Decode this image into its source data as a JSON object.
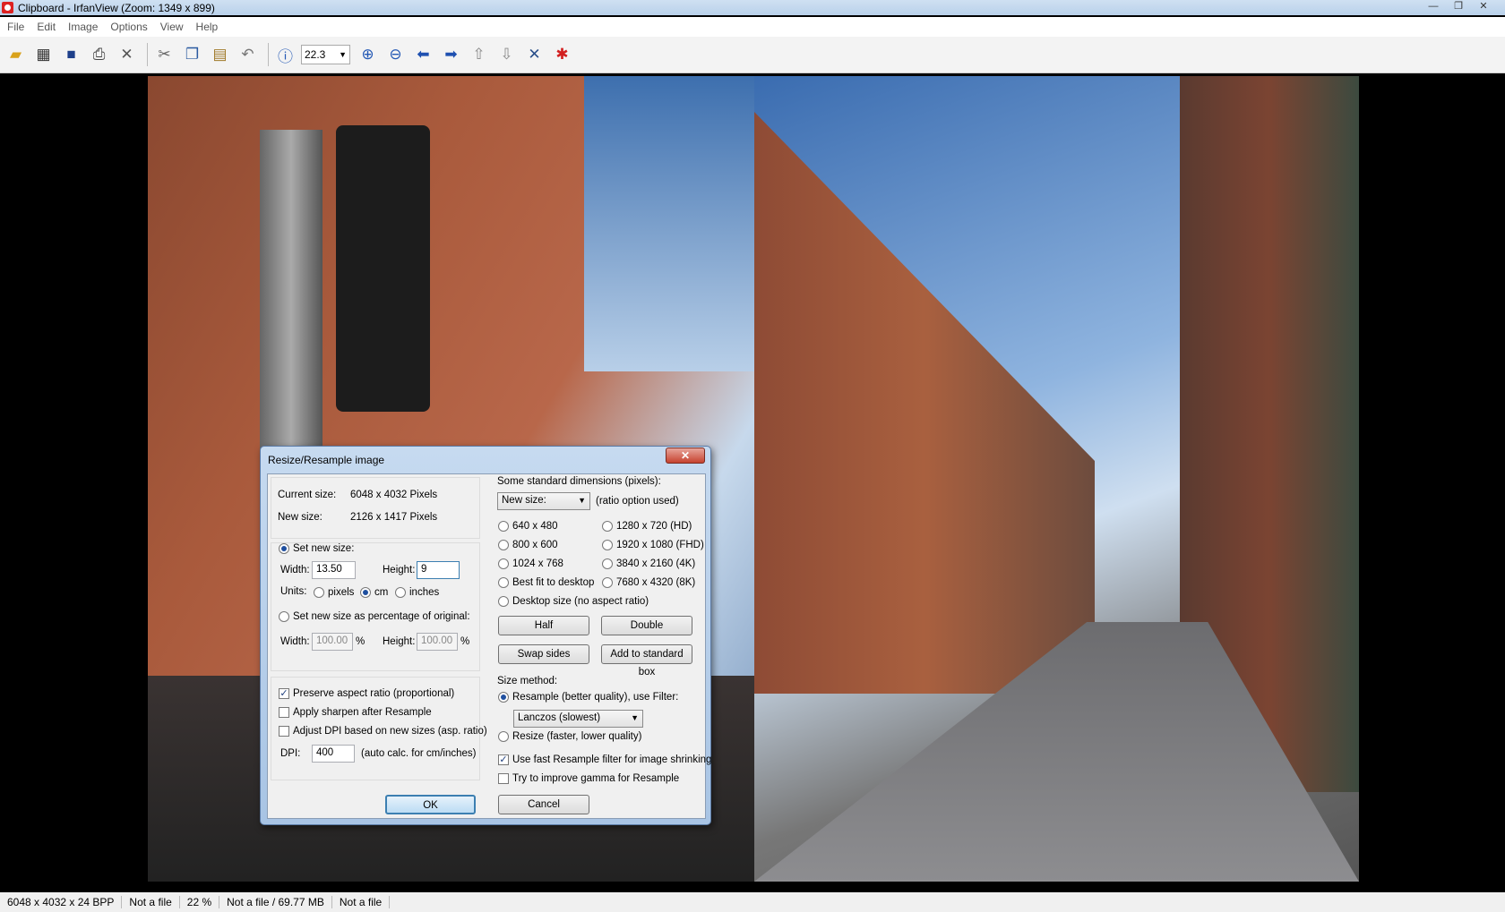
{
  "window": {
    "title": "Clipboard - IrfanView (Zoom: 1349 x 899)",
    "controls": [
      "—",
      "❐",
      "✕"
    ]
  },
  "menu": [
    "File",
    "Edit",
    "Image",
    "Options",
    "View",
    "Help"
  ],
  "toolbar": {
    "zoom_value": "22.3",
    "icons": [
      "open-folder-icon",
      "thumbnails-icon",
      "save-icon",
      "print-icon",
      "delete-icon",
      "cut-icon",
      "copy-icon",
      "paste-icon",
      "undo-icon",
      "info-icon",
      "zoom-in-icon",
      "zoom-out-icon",
      "previous-icon",
      "next-icon",
      "first-page-icon",
      "last-page-icon",
      "settings-icon",
      "exit-icon"
    ]
  },
  "statusbar": [
    "6048 x 4032 x 24 BPP",
    "Not a file",
    "22 %",
    "Not a file / 69.77 MB",
    "Not a file"
  ],
  "dialog": {
    "title": "Resize/Resample image",
    "close": "✕",
    "current_size_label": "Current size:",
    "current_size_value": "6048  x  4032  Pixels",
    "new_size_label": "New size:",
    "new_size_value": "2126  x  1417  Pixels",
    "set_new_size": "Set new size:",
    "width_label": "Width:",
    "width_value": "13.50",
    "height_label": "Height:",
    "height_value": "9",
    "units_label": "Units:",
    "unit_pixels": "pixels",
    "unit_cm": "cm",
    "unit_inches": "inches",
    "set_percentage": "Set new size as percentage of original:",
    "pct_width_label": "Width:",
    "pct_width_value": "100.00",
    "pct_height_label": "Height:",
    "pct_height_value": "100.00",
    "pct_sign": "%",
    "preserve_aspect": "Preserve aspect ratio (proportional)",
    "apply_sharpen": "Apply sharpen after Resample",
    "adjust_dpi": "Adjust DPI based on new sizes (asp. ratio)",
    "dpi_label": "DPI:",
    "dpi_value": "400",
    "dpi_note": "(auto calc. for cm/inches)",
    "std_dims_label": "Some standard dimensions (pixels):",
    "std_dims_select": "New size:",
    "ratio_note": "(ratio option used)",
    "dims_col1": [
      "640 x 480",
      "800 x 600",
      "1024 x 768",
      "Best fit to desktop",
      "Desktop size (no aspect ratio)"
    ],
    "dims_col2": [
      "1280 x 720   (HD)",
      "1920 x 1080 (FHD)",
      "3840 x 2160 (4K)",
      "7680 x 4320 (8K)"
    ],
    "btn_half": "Half",
    "btn_double": "Double",
    "btn_swap": "Swap sides",
    "btn_add_std": "Add to standard box",
    "size_method_label": "Size method:",
    "resample_option": "Resample (better quality), use Filter:",
    "filter_value": "Lanczos (slowest)",
    "resize_option": "Resize (faster, lower quality)",
    "fast_resample": "Use fast Resample filter for image shrinking",
    "improve_gamma": "Try to improve gamma for Resample",
    "ok": "OK",
    "cancel": "Cancel"
  }
}
